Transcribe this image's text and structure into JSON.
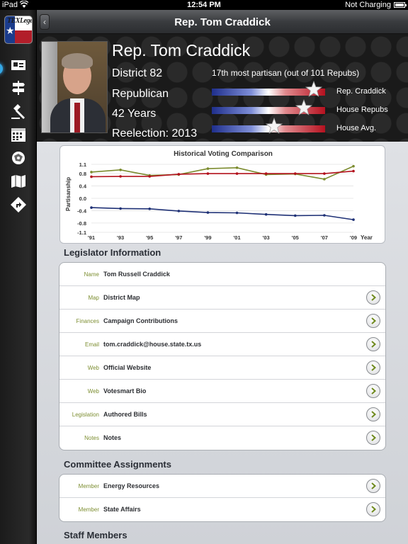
{
  "status_bar": {
    "carrier": "iPad",
    "time": "12:54 PM",
    "charging": "Not Charging"
  },
  "nav_bar": {
    "title": "Rep. Tom Craddick"
  },
  "sidebar": {
    "logo_text": "TEXLege",
    "items": [
      {
        "icon": "person-card-icon"
      },
      {
        "icon": "signpost-icon"
      },
      {
        "icon": "gavel-icon"
      },
      {
        "icon": "calendar-icon"
      },
      {
        "icon": "district-map-icon"
      },
      {
        "icon": "map-icon"
      },
      {
        "icon": "directions-icon"
      }
    ]
  },
  "profile": {
    "name": "Rep. Tom Craddick",
    "district": "District 82",
    "party": "Republican",
    "tenure": "42 Years",
    "reelection": "Reelection: 2013",
    "partisan_note": "17th most partisan (out of 101 Repubs)",
    "bars": [
      {
        "label": "Rep. Craddick",
        "position": 0.9
      },
      {
        "label": "House Repubs",
        "position": 0.81
      },
      {
        "label": "House Avg.",
        "position": 0.55
      }
    ]
  },
  "chart_data": {
    "type": "line",
    "title": "Historical Voting Comparison",
    "ylabel": "Partisanship",
    "xlabel": "Year",
    "categories": [
      "'91",
      "'93",
      "'95",
      "'97",
      "'99",
      "'01",
      "'03",
      "'05",
      "'07",
      "'09"
    ],
    "yticks": [
      "1.1",
      "0.8",
      "0.4",
      "0.0",
      "-0.4",
      "-0.8",
      "-1.1"
    ],
    "ylim": [
      -1.1,
      1.1
    ],
    "series": [
      {
        "color": "#7b8b2e",
        "values": [
          0.85,
          0.92,
          0.74,
          0.77,
          0.96,
          0.99,
          0.77,
          0.79,
          0.62,
          1.04
        ]
      },
      {
        "color": "#b3121d",
        "values": [
          0.7,
          0.71,
          0.71,
          0.78,
          0.8,
          0.8,
          0.8,
          0.8,
          0.8,
          0.88
        ]
      },
      {
        "color": "#1f3176",
        "values": [
          -0.3,
          -0.33,
          -0.34,
          -0.41,
          -0.46,
          -0.47,
          -0.52,
          -0.56,
          -0.55,
          -0.69
        ]
      }
    ]
  },
  "legislator_info": {
    "title": "Legislator Information",
    "rows": [
      {
        "key": "Name",
        "value": "Tom Russell Craddick",
        "action": false
      },
      {
        "key": "Map",
        "value": "District Map",
        "action": true
      },
      {
        "key": "Finances",
        "value": "Campaign Contributions",
        "action": true
      },
      {
        "key": "Email",
        "value": "tom.craddick@house.state.tx.us",
        "action": true
      },
      {
        "key": "Web",
        "value": "Official Website",
        "action": true
      },
      {
        "key": "Web",
        "value": "Votesmart Bio",
        "action": true
      },
      {
        "key": "Legislation",
        "value": "Authored Bills",
        "action": true
      },
      {
        "key": "Notes",
        "value": "Notes",
        "action": true
      }
    ]
  },
  "committees": {
    "title": "Committee Assignments",
    "rows": [
      {
        "key": "Member",
        "value": "Energy Resources",
        "action": true
      },
      {
        "key": "Member",
        "value": "State Affairs",
        "action": true
      }
    ]
  },
  "staff": {
    "title": "Staff Members"
  },
  "colors": {
    "accent_green": "#7e8f33",
    "republican_red": "#b5111f",
    "democrat_blue": "#1f2f8c"
  }
}
